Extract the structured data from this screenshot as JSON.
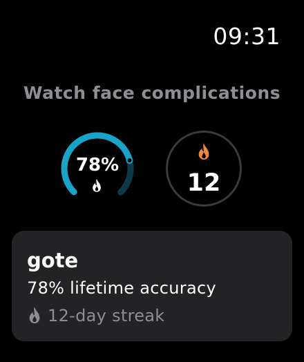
{
  "status_bar": {
    "time": "09:31"
  },
  "section": {
    "title": "Watch face complications"
  },
  "complications": {
    "accuracy_ring": {
      "percent_label": "78%",
      "progress": 0.78,
      "ring_color": "#1aa3c8",
      "icon": "flame-icon"
    },
    "streak_circle": {
      "value": "12",
      "icon": "flame-icon",
      "icon_color": "#f0873a"
    }
  },
  "card": {
    "username": "gote",
    "accuracy_text": "78% lifetime accuracy",
    "streak_icon": "flame-icon",
    "streak_text": "12-day streak"
  }
}
